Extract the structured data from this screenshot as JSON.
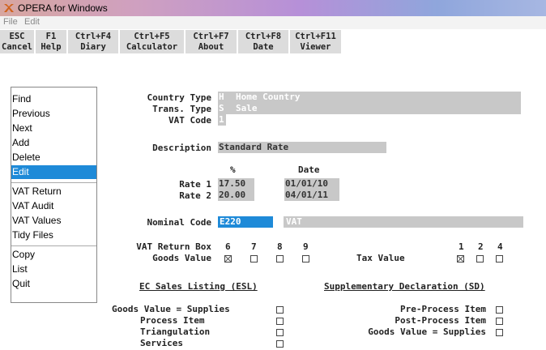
{
  "window": {
    "title": "OPERA for Windows"
  },
  "menubar": [
    "File",
    "Edit"
  ],
  "fkeys": [
    {
      "key": "ESC",
      "label": "Cancel"
    },
    {
      "key": "F1",
      "label": "Help"
    },
    {
      "key": "Ctrl+F4",
      "label": "Diary"
    },
    {
      "key": "Ctrl+F5",
      "label": "Calculator"
    },
    {
      "key": "Ctrl+F7",
      "label": "About"
    },
    {
      "key": "Ctrl+F8",
      "label": "Date"
    },
    {
      "key": "Ctrl+F11",
      "label": "Viewer"
    }
  ],
  "sidemenu": {
    "items": [
      "Find",
      "Previous",
      "Next",
      "Add",
      "Delete",
      "Edit",
      "VAT Return",
      "VAT Audit",
      "VAT Values",
      "Tidy Files",
      "Copy",
      "List",
      "Quit"
    ],
    "selected": "Edit"
  },
  "form": {
    "country_type": {
      "label": "Country Type",
      "code": "H",
      "value": "Home Country"
    },
    "trans_type": {
      "label": "Trans. Type",
      "code": "S",
      "value": "Sale"
    },
    "vat_code": {
      "label": "VAT Code",
      "value": "1"
    },
    "description": {
      "label": "Description",
      "value": "Standard Rate"
    },
    "rate_header_pct": "%",
    "rate_header_date": "Date",
    "rate1": {
      "label": "Rate 1",
      "pct": "17.50",
      "date": "01/01/10"
    },
    "rate2": {
      "label": "Rate 2",
      "pct": "20.00",
      "date": "04/01/11"
    },
    "nominal_code": {
      "label": "Nominal Code",
      "code": "E220",
      "name": "VAT"
    },
    "vat_return_box": {
      "label": "VAT Return Box",
      "goods_label": "Goods Value",
      "tax_label": "Tax Value",
      "goods_boxes": [
        {
          "n": "6",
          "checked": true
        },
        {
          "n": "7",
          "checked": false
        },
        {
          "n": "8",
          "checked": false
        },
        {
          "n": "9",
          "checked": false
        }
      ],
      "tax_boxes": [
        {
          "n": "1",
          "checked": true
        },
        {
          "n": "2",
          "checked": false
        },
        {
          "n": "4",
          "checked": false
        }
      ]
    },
    "esl": {
      "heading": "EC Sales Listing (ESL)",
      "items": [
        {
          "label": "Goods Value = Supplies",
          "checked": false
        },
        {
          "label": "Process Item",
          "checked": false
        },
        {
          "label": "Triangulation",
          "checked": false
        },
        {
          "label": "Services",
          "checked": false
        }
      ]
    },
    "sd": {
      "heading": "Supplementary Declaration (SD)",
      "items": [
        {
          "label": "Pre-Process Item",
          "checked": false
        },
        {
          "label": "Post-Process Item",
          "checked": false
        },
        {
          "label": "Goods Value = Supplies",
          "checked": false
        }
      ]
    }
  },
  "colors": {
    "accent": "#1e8ad8",
    "field": "#c8c8c8",
    "fkey_bg": "#dcdcdc"
  }
}
